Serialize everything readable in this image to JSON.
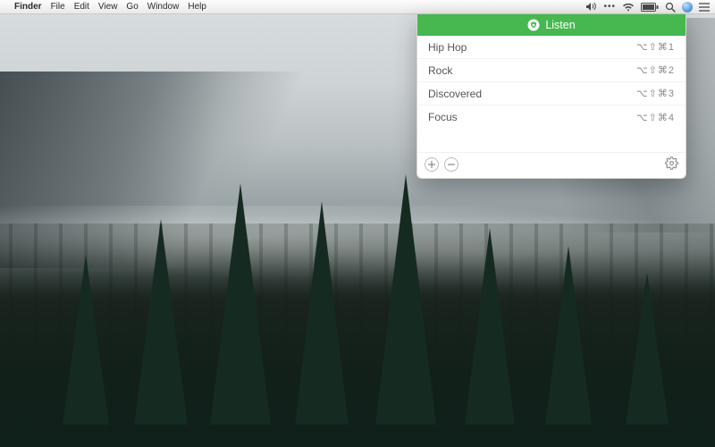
{
  "menubar": {
    "app_name": "Finder",
    "menus": [
      "File",
      "Edit",
      "View",
      "Go",
      "Window",
      "Help"
    ],
    "status_icons": [
      "volume-icon",
      "more-icon",
      "wifi-icon",
      "battery-icon",
      "search-icon",
      "siri-icon",
      "notifications-icon"
    ]
  },
  "panel": {
    "title": "Listen",
    "accent_color": "#46b84f",
    "items": [
      {
        "name": "Hip Hop",
        "shortcut": "⌥⇧⌘1"
      },
      {
        "name": "Rock",
        "shortcut": "⌥⇧⌘2"
      },
      {
        "name": "Discovered",
        "shortcut": "⌥⇧⌘3"
      },
      {
        "name": "Focus",
        "shortcut": "⌥⇧⌘4"
      }
    ],
    "footer_icons": {
      "add": "add-icon",
      "remove": "remove-icon",
      "settings": "gear-icon"
    }
  }
}
